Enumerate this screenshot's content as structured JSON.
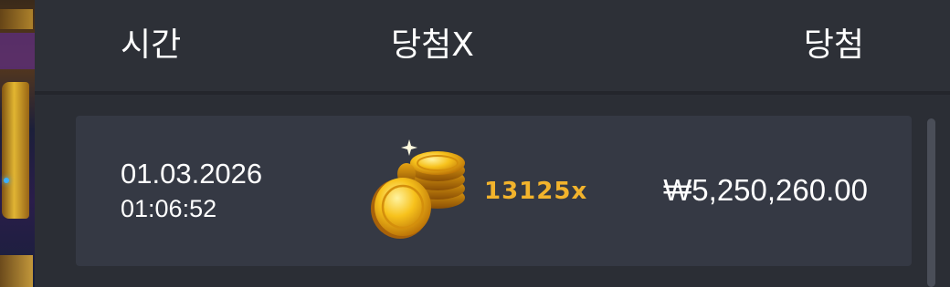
{
  "table": {
    "headers": {
      "time": "시간",
      "multiplier": "당첨X",
      "win": "당첨"
    },
    "rows": [
      {
        "date": "01.03.2026",
        "time": "01:06:52",
        "icon": "gold-coins-icon",
        "multiplier": "13125x",
        "amount": "₩5,250,260.00"
      }
    ]
  },
  "colors": {
    "panel_bg": "#2b2e35",
    "row_bg": "#353944",
    "multiplier_text": "#f2b32c",
    "text": "#ffffff"
  }
}
